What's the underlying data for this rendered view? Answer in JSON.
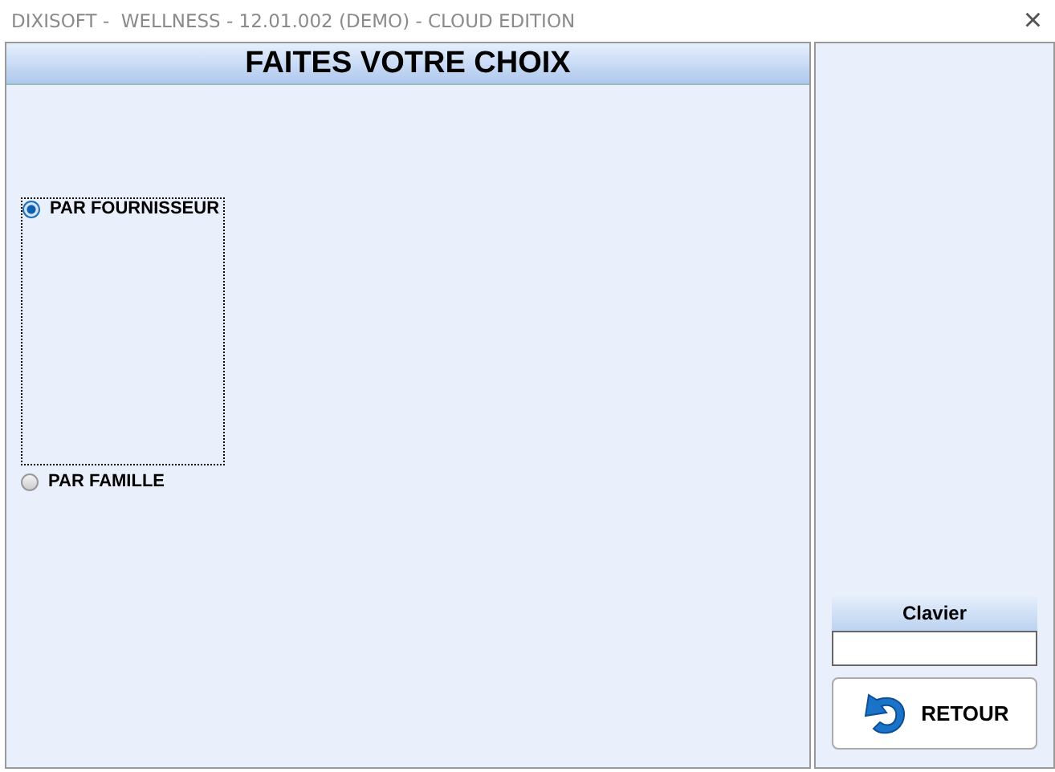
{
  "window": {
    "title": "DIXISOFT -  WELLNESS - 12.01.002 (DEMO) - CLOUD EDITION",
    "close": "×"
  },
  "header": "FAITES VOTRE CHOIX",
  "options": [
    {
      "label": "PAR FOURNISSEUR",
      "selected": true
    },
    {
      "label": "PAR FAMILLE",
      "selected": false
    }
  ],
  "keyboard": {
    "label": "Clavier"
  },
  "buttons": [
    {
      "label": "RETOUR"
    }
  ]
}
